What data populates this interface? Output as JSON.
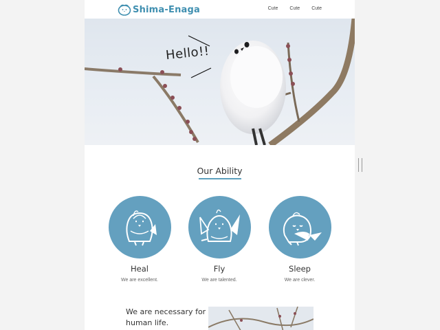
{
  "header": {
    "logo_text": "Shima-Enaga",
    "nav": [
      "Cute",
      "Cute",
      "Cute"
    ]
  },
  "hero": {
    "greeting": "Hello!!"
  },
  "ability_section": {
    "title": "Our Ability",
    "items": [
      {
        "name": "Heal",
        "description": "We are excellent."
      },
      {
        "name": "Fly",
        "description": "We are talented."
      },
      {
        "name": "Sleep",
        "description": "We are clever."
      }
    ]
  },
  "claim": {
    "text": "We are necessary for human life."
  },
  "colors": {
    "brand": "#3f8fb0",
    "circle": "#64a0bf",
    "accent_line": "#5b9fbd"
  },
  "icons": [
    "bird-logo-icon",
    "bird-heal-icon",
    "bird-fly-icon",
    "bird-sleep-icon"
  ]
}
